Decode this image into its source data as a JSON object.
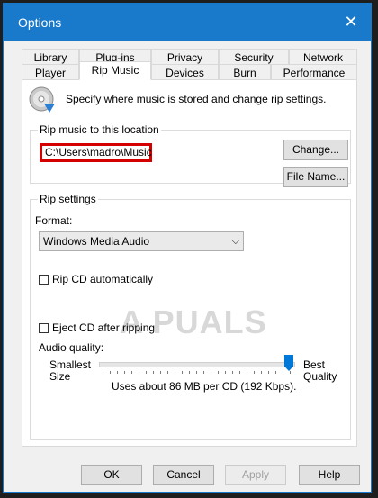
{
  "window": {
    "title": "Options",
    "close_glyph": "✕"
  },
  "tabs": {
    "row1": [
      "Library",
      "Plug-ins",
      "Privacy",
      "Security",
      "Network"
    ],
    "row2": [
      "Player",
      "Rip Music",
      "Devices",
      "Burn",
      "Performance"
    ],
    "active": "Rip Music"
  },
  "intro_text": "Specify where music is stored and change rip settings.",
  "location": {
    "group_label": "Rip music to this location",
    "path": "C:\\Users\\madro\\Music",
    "change_label": "Change...",
    "filename_label": "File Name..."
  },
  "rip_settings": {
    "group_label": "Rip settings",
    "format_label": "Format:",
    "format_value": "Windows Media Audio",
    "rip_auto_label": "Rip CD automatically",
    "rip_auto_checked": false,
    "eject_label": "Eject CD after ripping",
    "eject_checked": false,
    "audio_quality_label": "Audio quality:",
    "smallest": "Smallest",
    "size": "Size",
    "best": "Best",
    "quality": "Quality",
    "usage_text": "Uses about 86 MB per CD (192 Kbps).",
    "slider_level": 1.0
  },
  "watermark": "A  PUALS",
  "footer": {
    "ok": "OK",
    "cancel": "Cancel",
    "apply": "Apply",
    "help": "Help"
  },
  "colors": {
    "title_bar": "#1979ca",
    "highlight_border": "#d40000",
    "slider": "#0078d7"
  }
}
